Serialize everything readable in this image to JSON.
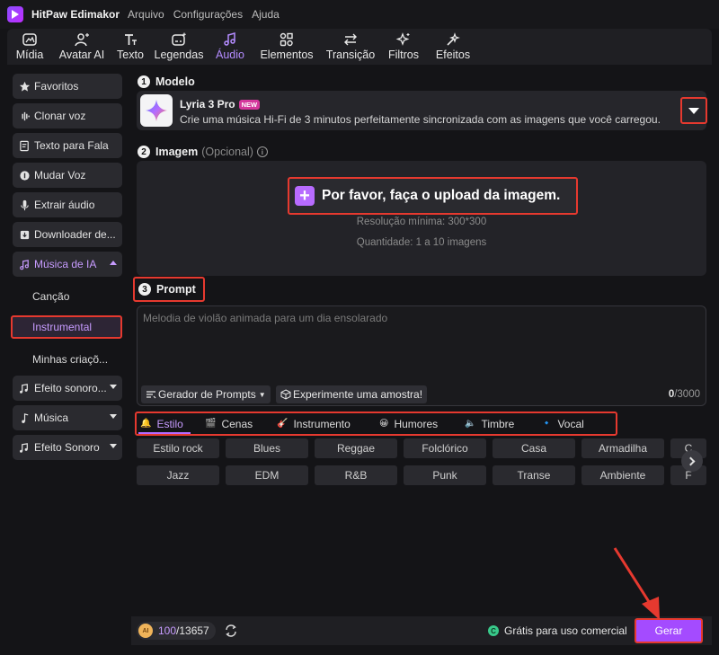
{
  "app": {
    "name": "HitPaw Edimakor",
    "menu": [
      "Arquivo",
      "Configurações",
      "Ajuda"
    ]
  },
  "toolbar": {
    "items": [
      {
        "label": "Mídia",
        "icon": "media-icon"
      },
      {
        "label": "Avatar AI",
        "icon": "avatar-icon"
      },
      {
        "label": "Texto",
        "icon": "text-icon"
      },
      {
        "label": "Legendas",
        "icon": "subtitles-icon"
      },
      {
        "label": "Áudio",
        "icon": "audio-icon",
        "active": true
      },
      {
        "label": "Elementos",
        "icon": "elements-icon"
      },
      {
        "label": "Transição",
        "icon": "transition-icon"
      },
      {
        "label": "Filtros",
        "icon": "filters-icon"
      },
      {
        "label": "Efeitos",
        "icon": "effects-icon"
      }
    ]
  },
  "sidebar": {
    "items": [
      {
        "label": "Favoritos",
        "icon": "star-icon"
      },
      {
        "label": "Clonar voz",
        "icon": "clone-voice-icon"
      },
      {
        "label": "Texto para Fala",
        "icon": "text-to-speech-icon"
      },
      {
        "label": "Mudar Voz",
        "icon": "voice-changer-icon"
      },
      {
        "label": "Extrair áudio",
        "icon": "microphone-icon"
      },
      {
        "label": "Downloader de...",
        "icon": "download-icon"
      },
      {
        "label": "Música de IA",
        "icon": "ai-music-icon",
        "expanded": true
      },
      {
        "label": "Efeito sonoro...",
        "icon": "sound-effect-icon"
      },
      {
        "label": "Música",
        "icon": "music-note-icon"
      },
      {
        "label": "Efeito Sonoro",
        "icon": "sound-effect-icon"
      }
    ],
    "subitems": [
      {
        "label": "Canção"
      },
      {
        "label": "Instrumental",
        "selected": true
      },
      {
        "label": "Minhas criaçõ..."
      }
    ]
  },
  "model": {
    "step": "1",
    "title": "Modelo",
    "name": "Lyria 3 Pro",
    "badge": "NEW",
    "description": "Crie uma música Hi-Fi de 3 minutos perfeitamente sincronizada com as imagens que você carregou."
  },
  "image": {
    "step": "2",
    "title": "Imagem",
    "optional": "(Opcional)",
    "upload_label": "Por favor, faça o upload da imagem.",
    "min_resolution": "Resolução mínima: 300*300",
    "quantity": "Quantidade: 1 a 10 imagens"
  },
  "prompt": {
    "step": "3",
    "title": "Prompt",
    "placeholder": "Melodia de violão animada para um dia ensolarado",
    "generator_label": "Gerador de Prompts",
    "sample_label": "Experimente uma amostra!",
    "count": "0",
    "max": "/3000"
  },
  "tabs": [
    {
      "label": "Estilo",
      "icon": "style-icon",
      "active": true
    },
    {
      "label": "Cenas",
      "icon": "scenes-icon"
    },
    {
      "label": "Instrumento",
      "icon": "instrument-icon"
    },
    {
      "label": "Humores",
      "icon": "mood-icon"
    },
    {
      "label": "Timbre",
      "icon": "timbre-icon"
    },
    {
      "label": "Vocal",
      "icon": "vocal-icon"
    }
  ],
  "genres": [
    [
      "Estilo rock",
      "Blues",
      "Reggae",
      "Folclórico",
      "Casa",
      "Armadilha",
      "C"
    ],
    [
      "Jazz",
      "EDM",
      "R&B",
      "Punk",
      "Transe",
      "Ambiente",
      "F"
    ]
  ],
  "footer": {
    "credits_used": "100",
    "credits_total": "/13657",
    "free_label": "Grátis para uso comercial",
    "generate_label": "Gerar"
  },
  "colors": {
    "accent": "#b76bff",
    "highlight": "#e6392f",
    "generate": "#a44bff"
  }
}
